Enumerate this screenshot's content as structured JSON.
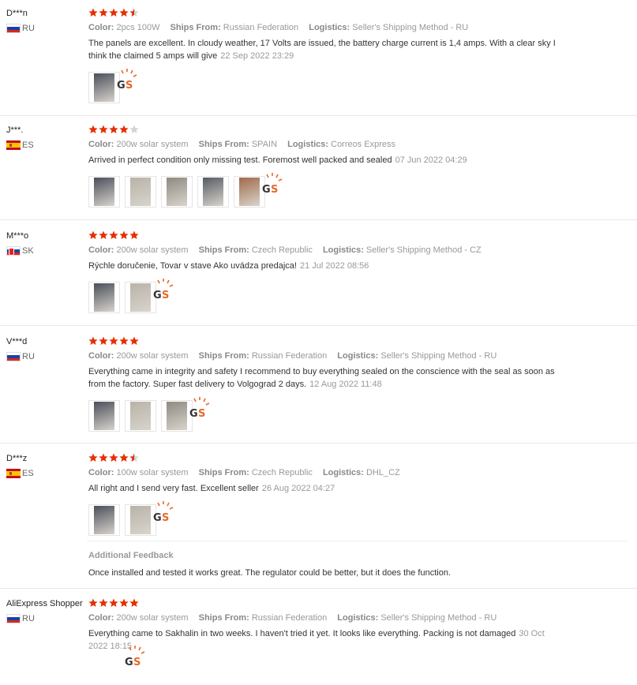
{
  "colors": {
    "star_filled": "#e62e04",
    "star_empty": "#d3d3d3",
    "accent": "#e8692a"
  },
  "labels": {
    "color": "Color:",
    "ships_from": "Ships From:",
    "logistics": "Logistics:",
    "additional_feedback": "Additional Feedback"
  },
  "reviews": [
    {
      "user": "D***n",
      "country": "RU",
      "rating": 4.5,
      "color": "2pcs 100W",
      "ships_from": "Russian Federation",
      "logistics": "Seller's Shipping Method - RU",
      "text": "The panels are excellent. In cloudy weather, 17 Volts are issued, the battery charge current is 1,4 amps. With a clear sky I think the claimed 5 amps will give",
      "date": "22 Sep 2022 23:29",
      "photos": 1
    },
    {
      "user": "J***.",
      "country": "ES",
      "rating": 4,
      "color": "200w solar system",
      "ships_from": "SPAIN",
      "logistics": "Correos Express",
      "text": "Arrived in perfect condition only missing test. Foremost well packed and sealed",
      "date": "07 Jun 2022 04:29",
      "photos": 5
    },
    {
      "user": "M***o",
      "country": "SK",
      "rating": 5,
      "color": "200w solar system",
      "ships_from": "Czech Republic",
      "logistics": "Seller's Shipping Method - CZ",
      "text": "Rýchle doručenie, Tovar v stave Ako uvádza predajca!",
      "date": "21 Jul 2022 08:56",
      "photos": 2
    },
    {
      "user": "V***d",
      "country": "RU",
      "rating": 5,
      "color": "200w solar system",
      "ships_from": "Russian Federation",
      "logistics": "Seller's Shipping Method - RU",
      "text": "Everything came in integrity and safety I recommend to buy everything sealed on the conscience with the seal as soon as from the factory. Super fast delivery to Volgograd 2 days.",
      "date": "12 Aug 2022 11:48",
      "photos": 3
    },
    {
      "user": "D***z",
      "country": "ES",
      "rating": 4.5,
      "color": "100w solar system",
      "ships_from": "Czech Republic",
      "logistics": "DHL_CZ",
      "text": "All right and I send very fast. Excellent seller",
      "date": "26 Aug 2022 04:27",
      "photos": 2,
      "additional_feedback": "Once installed and tested it works great. The regulator could be better, but it does the function."
    },
    {
      "user": "AliExpress Shopper",
      "country": "RU",
      "rating": 5,
      "color": "200w solar system",
      "ships_from": "Russian Federation",
      "logistics": "Seller's Shipping Method - RU",
      "text": "Everything came to Sakhalin in two weeks. I haven't tried it yet. It looks like everything. Packing is not damaged",
      "date": "30 Oct 2022 18:15",
      "photos": 0
    }
  ]
}
